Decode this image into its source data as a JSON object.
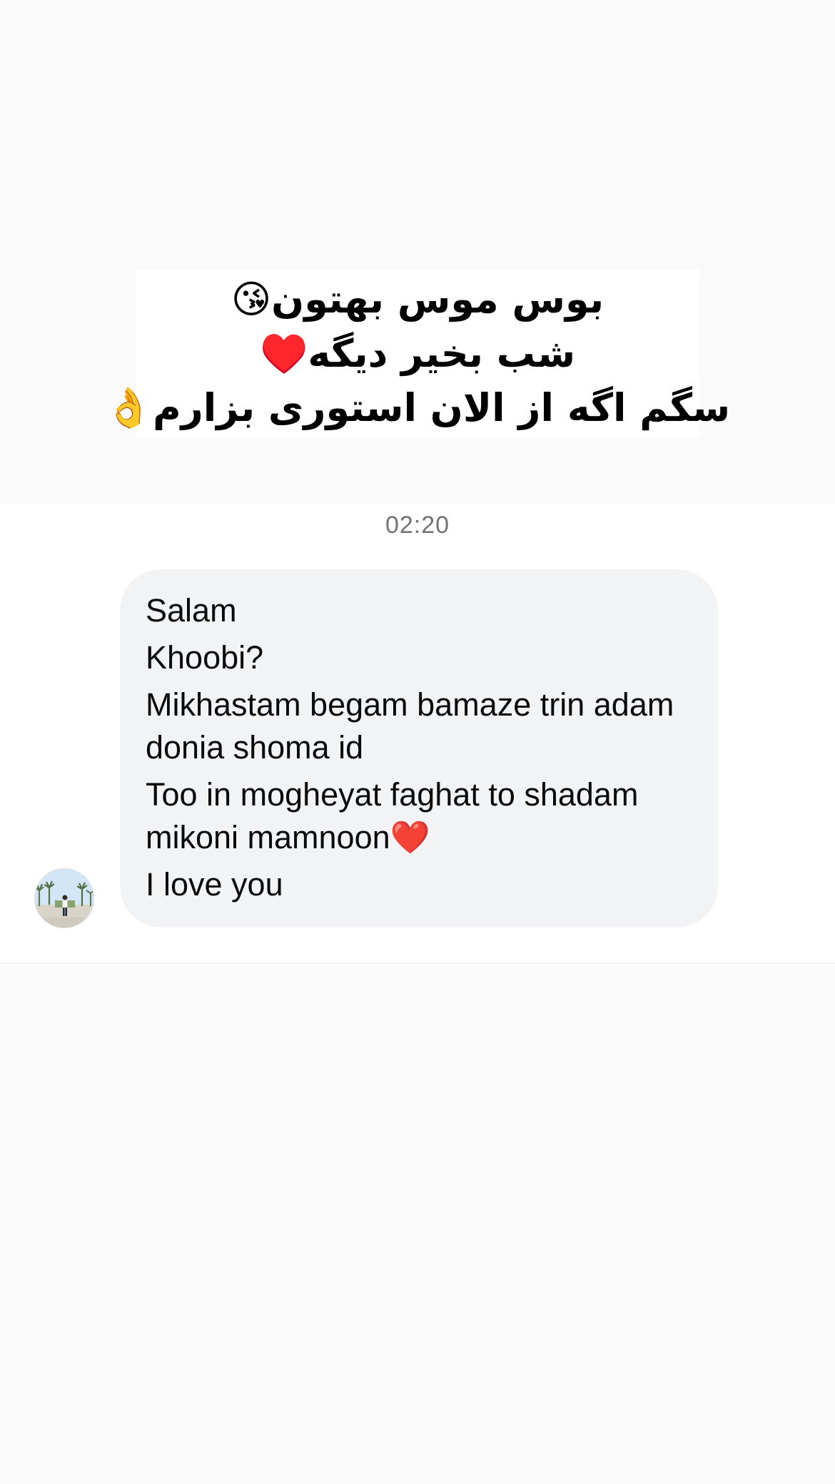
{
  "shared_text_image": {
    "lines": [
      "بوس موس بهتون😘",
      "شب بخیر دیگه♥️",
      "سگم اگه از الان استوری بزارم👌"
    ]
  },
  "timestamp": "02:20",
  "message": {
    "lines": [
      "Salam",
      "Khoobi?",
      "Mikhastam begam bamaze trin adam donia shoma id",
      "Too in mogheyat faghat to shadam mikoni mamnoon❤️",
      "I love you"
    ]
  },
  "sender": {
    "avatar_icon": "profile-photo"
  }
}
